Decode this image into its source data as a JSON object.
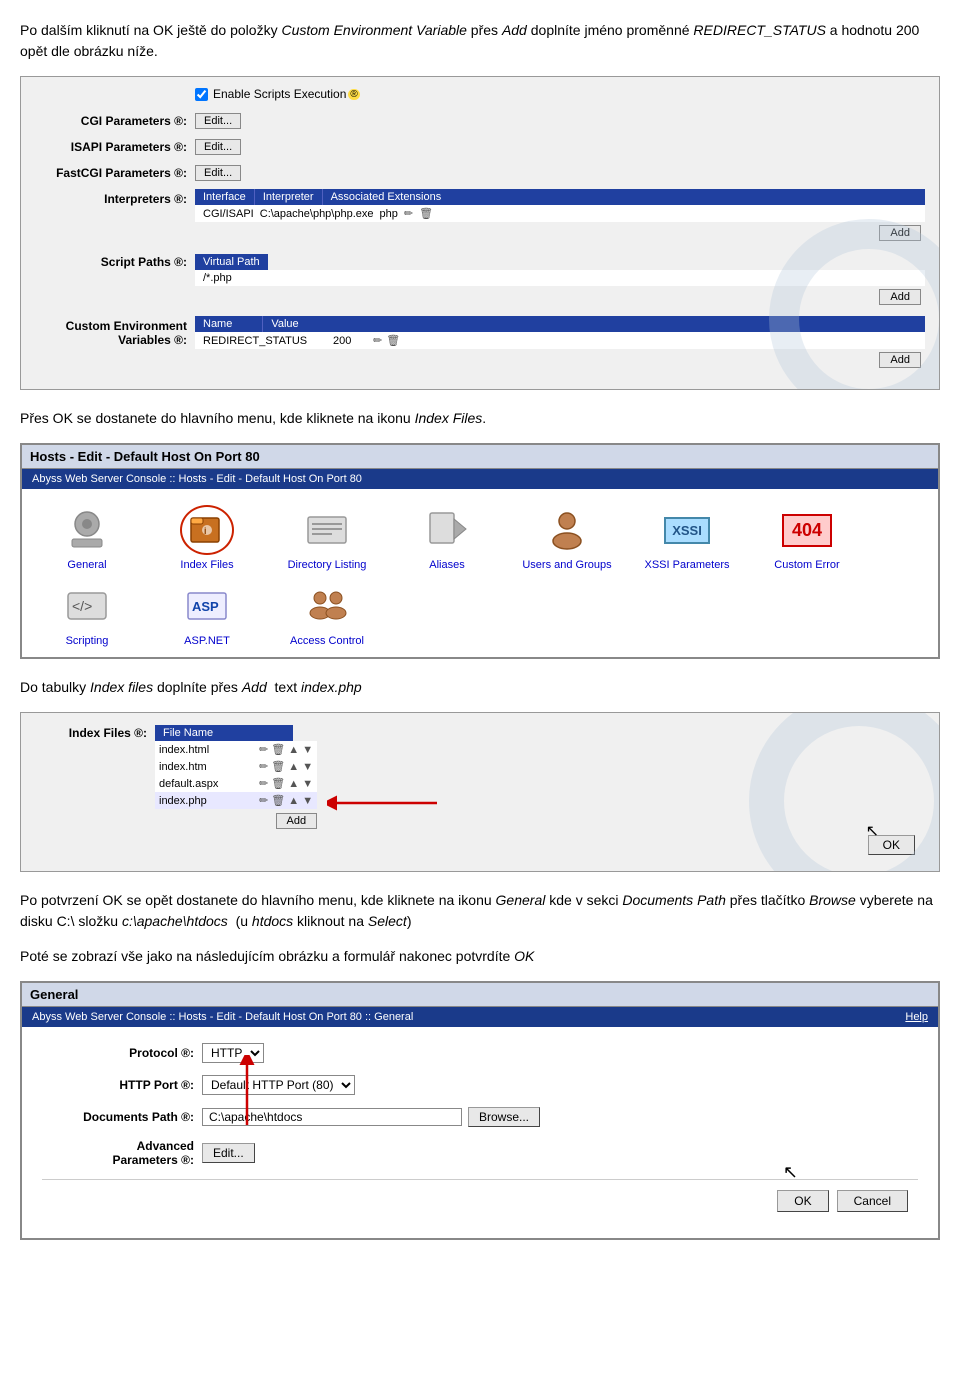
{
  "intro": {
    "para1": "Po dalším kliknutí na OK ještě do položky Custom Environment Variable přes Add doplníte jméno proměnné REDIRECT_STATUS a hodnotu 200 opět dle obrázku níže.",
    "para1_italic_1": "Custom Environment Variable",
    "para1_italic_2": "Add",
    "para1_bold": "REDIRECT_STATUS",
    "para2": "Přes OK se dostanete do hlavního menu, kde kliknete na ikonu Index Files.",
    "para2_italic": "Index Files",
    "para3": "Do tabulky Index files doplníte přes Add  text index.php",
    "para3_italic1": "Index files",
    "para3_italic2": "Add",
    "para3_code": "index.php",
    "para4_1": "Po potvrzení OK se opět dostanete do hlavního menu, kde kliknete na ikonu ",
    "para4_italic1": "General",
    "para4_1b": " kde v sekci ",
    "para4_italic2": "Documents Path",
    "para4_1c": " přes tlačítko ",
    "para4_italic3": "Browse",
    "para4_1d": " vyberete na disku C:\\ složku ",
    "para4_code1": "c:\\apache\\htdocs",
    "para4_1e": "  (u ",
    "para4_italic4": "htdocs",
    "para4_1f": " kliknout na ",
    "para4_italic5": "Select",
    "para4_1g": ")",
    "para5": "Poté se zobrazí vše jako na následujícím obrázku a formulář nakonec potvrdíte OK"
  },
  "s1": {
    "enable_scripts_label": "Enable Scripts Execution",
    "cgi_label": "CGI Parameters ®:",
    "isapi_label": "ISAPI Parameters ®:",
    "fastcgi_label": "FastCGI Parameters ®:",
    "interpreters_label": "Interpreters ®:",
    "script_paths_label": "Script Paths ®:",
    "custom_env_label": "Custom Environment Variables ®:",
    "edit_btn": "Edit...",
    "add_btn": "Add",
    "interp_cols": [
      "Interface",
      "Interpreter",
      "Associated Extensions"
    ],
    "interp_row": [
      "CGI/ISAPI",
      "C:\\apache\\php\\php.exe",
      "php"
    ],
    "virt_path_header": "Virtual Path",
    "virt_path_val": "/*.php",
    "env_cols": [
      "Name",
      "Value"
    ],
    "env_row_name": "REDIRECT_STATUS",
    "env_row_val": "200"
  },
  "s2": {
    "title": "Hosts - Edit - Default Host On Port 80",
    "breadcrumb": "Abyss Web Server Console :: Hosts - Edit - Default Host On Port 80",
    "icons": [
      {
        "id": "general",
        "label": "General",
        "icon": "⚙",
        "active": false
      },
      {
        "id": "indexfiles",
        "label": "Index Files",
        "icon": "📁",
        "active": true
      },
      {
        "id": "dirlisting",
        "label": "Directory Listing",
        "icon": "📋",
        "active": false
      },
      {
        "id": "aliases",
        "label": "Aliases",
        "icon": "📌",
        "active": false
      },
      {
        "id": "users",
        "label": "Users and Groups",
        "icon": "👤",
        "active": false
      },
      {
        "id": "xssi",
        "label": "XSSI Parameters",
        "icon": "XSSI",
        "active": false
      },
      {
        "id": "404",
        "label": "Custom Error",
        "icon": "404",
        "active": false
      },
      {
        "id": "scripting",
        "label": "Scripting",
        "icon": "⚙",
        "active": false
      },
      {
        "id": "aspnet",
        "label": "ASP.NET",
        "icon": "ASP",
        "active": false
      },
      {
        "id": "access",
        "label": "Access Control",
        "icon": "👥",
        "active": false
      }
    ]
  },
  "s3": {
    "label": "Index Files ®:",
    "file_name_header": "File Name",
    "files": [
      "index.html",
      "index.htm",
      "default.aspx",
      "index.php"
    ],
    "add_btn": "Add",
    "ok_btn": "OK"
  },
  "s4": {
    "title": "General",
    "breadcrumb": "Abyss Web Server Console :: Hosts - Edit - Default Host On Port 80 :: General",
    "help_link": "Help",
    "protocol_label": "Protocol ®:",
    "protocol_val": "HTTP",
    "http_port_label": "HTTP Port ®:",
    "http_port_val": "Default HTTP Port (80)",
    "docs_path_label": "Documents Path ®:",
    "docs_path_val": "C:\\apache\\htdocs",
    "browse_btn": "Browse...",
    "adv_label": "Advanced Parameters ®:",
    "edit_btn": "Edit...",
    "ok_btn": "OK",
    "cancel_btn": "Cancel"
  }
}
